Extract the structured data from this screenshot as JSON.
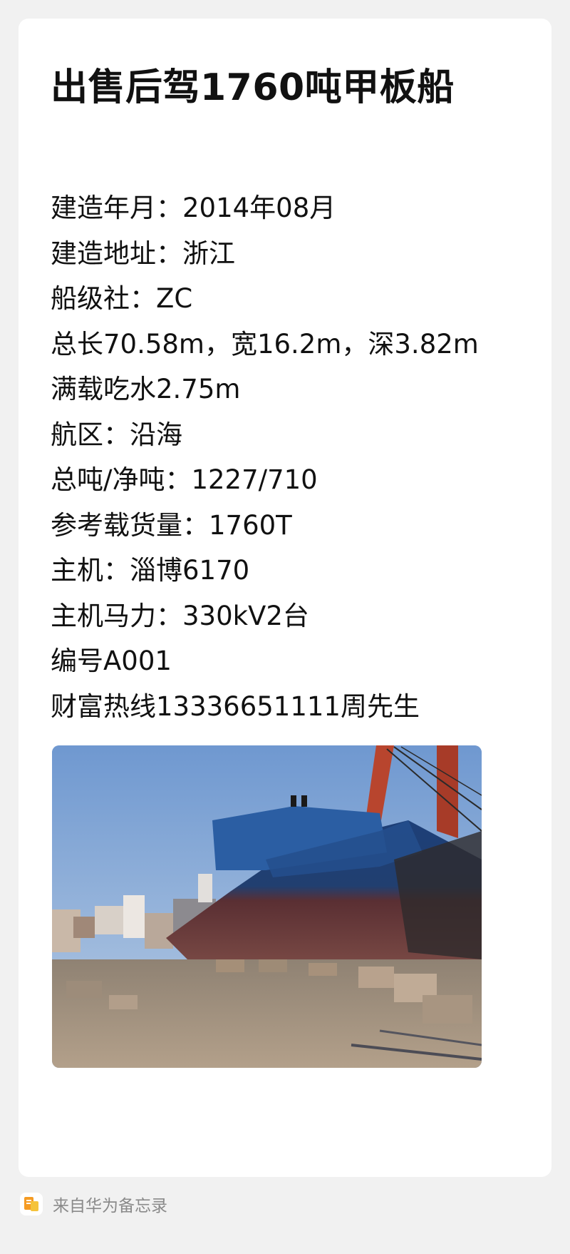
{
  "note": {
    "title": "出售后驾1760吨甲板船",
    "lines": [
      "建造年月：2014年08月",
      "建造地址：浙江",
      "船级社：ZC",
      "总长70.58m，宽16.2m，深3.82m",
      "满载吃水2.75m",
      "航区：沿海",
      "总吨/净吨：1227/710",
      "参考载货量：1760T",
      "主机：淄博6170",
      "主机马力：330kV2台",
      "编号A001",
      "财富热线13336651111周先生"
    ],
    "photo_icon": "ship-photo"
  },
  "footer": {
    "icon": "notes-app-icon",
    "text": "来自华为备忘录"
  }
}
